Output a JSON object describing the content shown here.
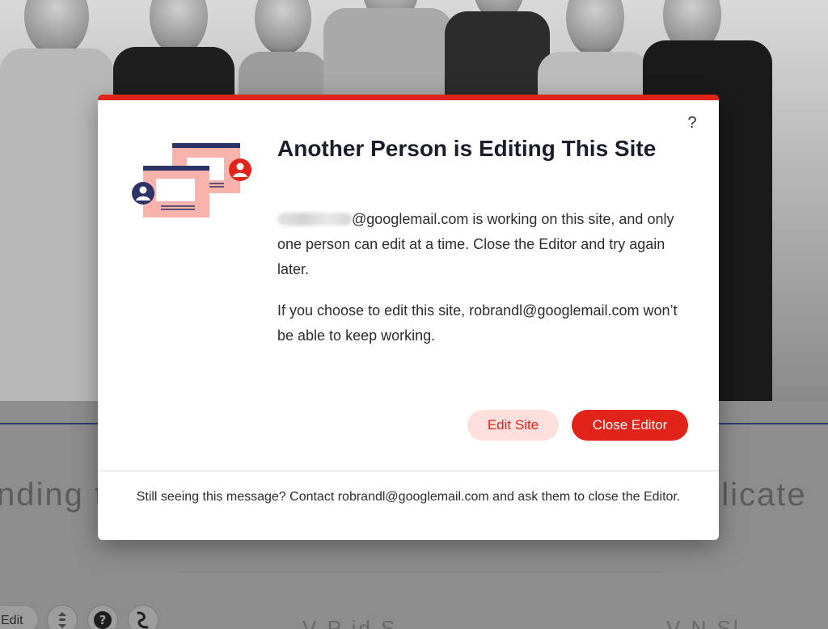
{
  "background": {
    "heading_left": "nding t",
    "heading_right": "plicate",
    "bottom_left": "V  P  id  S",
    "bottom_right": "V  N    Sl",
    "edit_pill_label": "Edit",
    "tools": [
      "layers-icon",
      "help-icon",
      "route-icon"
    ]
  },
  "modal": {
    "accent_color": "#e2231a",
    "help_label": "?",
    "title": "Another Person is Editing This Site",
    "body_line_1": "@googlemail.com is working on this site, and only one person can edit at a time. Close the Editor and try again later.",
    "body_line_2": "If you choose to edit this site, robrandl@googlemail.com won’t be able to keep working.",
    "buttons": {
      "edit_site": "Edit Site",
      "close_editor": "Close Editor"
    },
    "footer": "Still seeing this message? Contact robrandl@googlemail.com and ask them to close the Editor."
  }
}
